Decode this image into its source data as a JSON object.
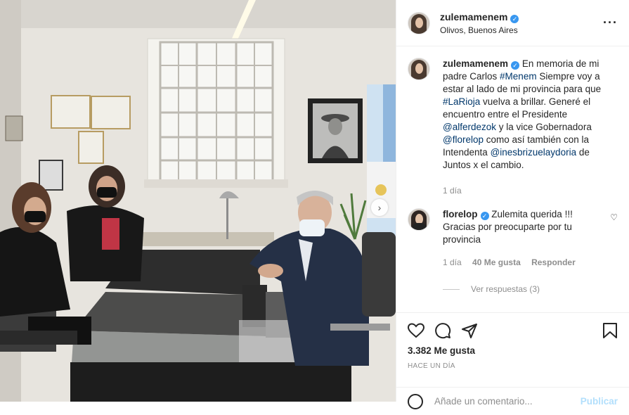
{
  "post": {
    "author": "zulemamenem",
    "location": "Olivos, Buenos Aires",
    "caption": {
      "t1": "En memoria de mi padre Carlos ",
      "tag1": "#Menem",
      "t2": " Siempre voy a estar al lado de mi provincia para que ",
      "tag2": "#LaRioja",
      "t3": " vuelva a brillar. Generé el encuentro entre el Presidente ",
      "tag3": "@alferdezok",
      "t4": " y la vice Gobernadora ",
      "tag4": "@florelop",
      "t5": " como así también con la Intendenta ",
      "tag5": "@inesbrizuelaydoria",
      "t6": " de Juntos x el cambio.",
      "time": "1 día"
    },
    "comment": {
      "author": "florelop",
      "text": "Zulemita querida !!! Gracias por preocuparte por tu provincia",
      "time": "1 día",
      "likes": "40 Me gusta",
      "reply": "Responder",
      "view_replies": "Ver respuestas (3)"
    },
    "likes": "3.382 Me gusta",
    "date": "HACE UN DÍA",
    "add_comment_placeholder": "Añade un comentario...",
    "publish": "Publicar"
  },
  "icons": [
    "more-options-icon",
    "verified-icon",
    "like-icon",
    "comment-icon",
    "share-icon",
    "save-icon",
    "emoji-icon",
    "carousel-next-icon",
    "comment-like-icon"
  ]
}
